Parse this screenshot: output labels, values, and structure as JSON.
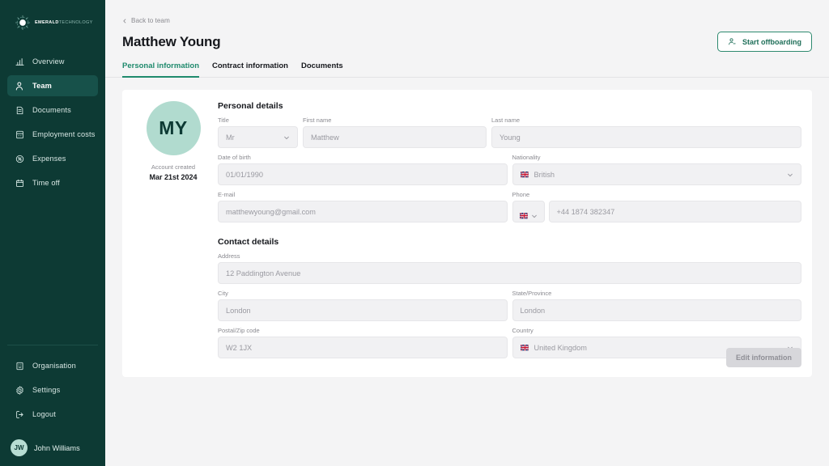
{
  "sidebar": {
    "logo": {
      "bold": "EMERALD",
      "light": "TECHNOLOGY",
      "icon": "emerald-logo-icon"
    },
    "items": [
      {
        "label": "Overview",
        "icon": "bar-chart-icon",
        "active": false
      },
      {
        "label": "Team",
        "icon": "people-icon",
        "active": true
      },
      {
        "label": "Documents",
        "icon": "document-icon",
        "active": false
      },
      {
        "label": "Employment costs",
        "icon": "calculator-icon",
        "active": false
      },
      {
        "label": "Expenses",
        "icon": "coin-percent-icon",
        "active": false
      },
      {
        "label": "Time off",
        "icon": "calendar-icon",
        "active": false
      }
    ],
    "bottom_items": [
      {
        "label": "Organisation",
        "icon": "building-icon"
      },
      {
        "label": "Settings",
        "icon": "gear-icon"
      },
      {
        "label": "Logout",
        "icon": "logout-icon"
      }
    ],
    "user": {
      "initials": "JW",
      "name": "John Williams"
    },
    "colors": {
      "background": "#0d3a34",
      "active": "#17514a",
      "text": "#d8e7e4"
    }
  },
  "header": {
    "back_link": "Back to team",
    "title": "Matthew Young",
    "offboard_button": "Start offboarding",
    "offboard_icon": "person-minus-icon",
    "accent": "#2e8a6f"
  },
  "tabs": [
    {
      "label": "Personal information",
      "active": true
    },
    {
      "label": "Contract information",
      "active": false
    },
    {
      "label": "Documents",
      "active": false
    }
  ],
  "profile": {
    "avatar_initials": "MY",
    "account_created_label": "Account created",
    "account_created_date": "Mar 21st 2024"
  },
  "personal_details": {
    "heading": "Personal details",
    "title": {
      "label": "Title",
      "value": "Mr",
      "icon": "chevron-down-icon"
    },
    "first_name": {
      "label": "First name",
      "value": "Matthew"
    },
    "last_name": {
      "label": "Last name",
      "value": "Young"
    },
    "date_of_birth": {
      "label": "Date of birth",
      "value": "01/01/1990"
    },
    "nationality": {
      "label": "Nationality",
      "value": "British",
      "flag": "uk-flag-icon",
      "icon": "chevron-down-icon"
    },
    "email": {
      "label": "E-mail",
      "value": "matthewyoung@gmail.com"
    },
    "phone": {
      "label": "Phone",
      "value": "+44 1874 382347",
      "flag": "uk-flag-icon",
      "icon": "chevron-down-icon"
    }
  },
  "contact_details": {
    "heading": "Contact details",
    "address": {
      "label": "Address",
      "value": "12 Paddington Avenue"
    },
    "city": {
      "label": "City",
      "value": "London"
    },
    "state": {
      "label": "State/Province",
      "value": "London"
    },
    "postal": {
      "label": "Postal/Zip code",
      "value": "W2 1JX"
    },
    "country": {
      "label": "Country",
      "value": "United Kingdom",
      "flag": "uk-flag-icon",
      "icon": "chevron-down-icon"
    }
  },
  "footer": {
    "edit_button": "Edit information"
  }
}
